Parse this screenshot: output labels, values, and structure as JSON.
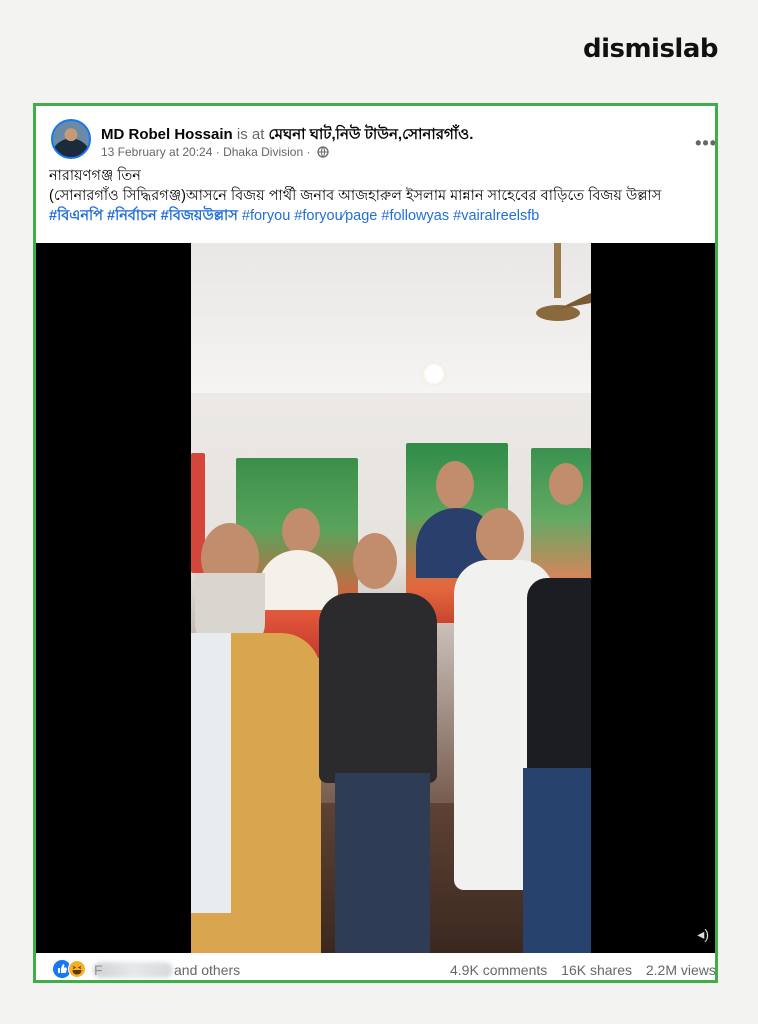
{
  "brand": {
    "logo_text": "dismislab"
  },
  "post": {
    "author": "MD Robel Hossain",
    "is_at": "is at",
    "location": "মেঘনা ঘাট,নিউ টাউন,সোনারগাঁও.",
    "timestamp": "13 February at 20:24",
    "separator": "·",
    "place": "Dhaka Division",
    "separator2": "·",
    "audience_icon": "globe-icon",
    "more_label": "•••",
    "caption_line1": "নারায়ণগঞ্জ তিন",
    "caption_line2": "(সোনারগাঁও  সিদ্ধিরগঞ্জ)আসনে বিজয় পার্থী জনাব আজহারুল ইসলাম মান্নান সাহেবের বাড়িতে বিজয় উল্লাস",
    "hashtags": [
      "#বিএনপি",
      "#নির্বাচন",
      "#বিজয়উল্লাস",
      "#foryou",
      "#foryou",
      "page",
      "#followyas",
      "#vairalreelsfb"
    ]
  },
  "footer": {
    "reactions": [
      "like-icon",
      "haha-icon"
    ],
    "reactor_name_visible": "F",
    "and_others": "and others",
    "comments": "4.9K comments",
    "shares": "16K shares",
    "views": "2.2M views"
  },
  "colors": {
    "border": "#3fae49",
    "link": "#216fdb",
    "muted": "#65676b"
  }
}
